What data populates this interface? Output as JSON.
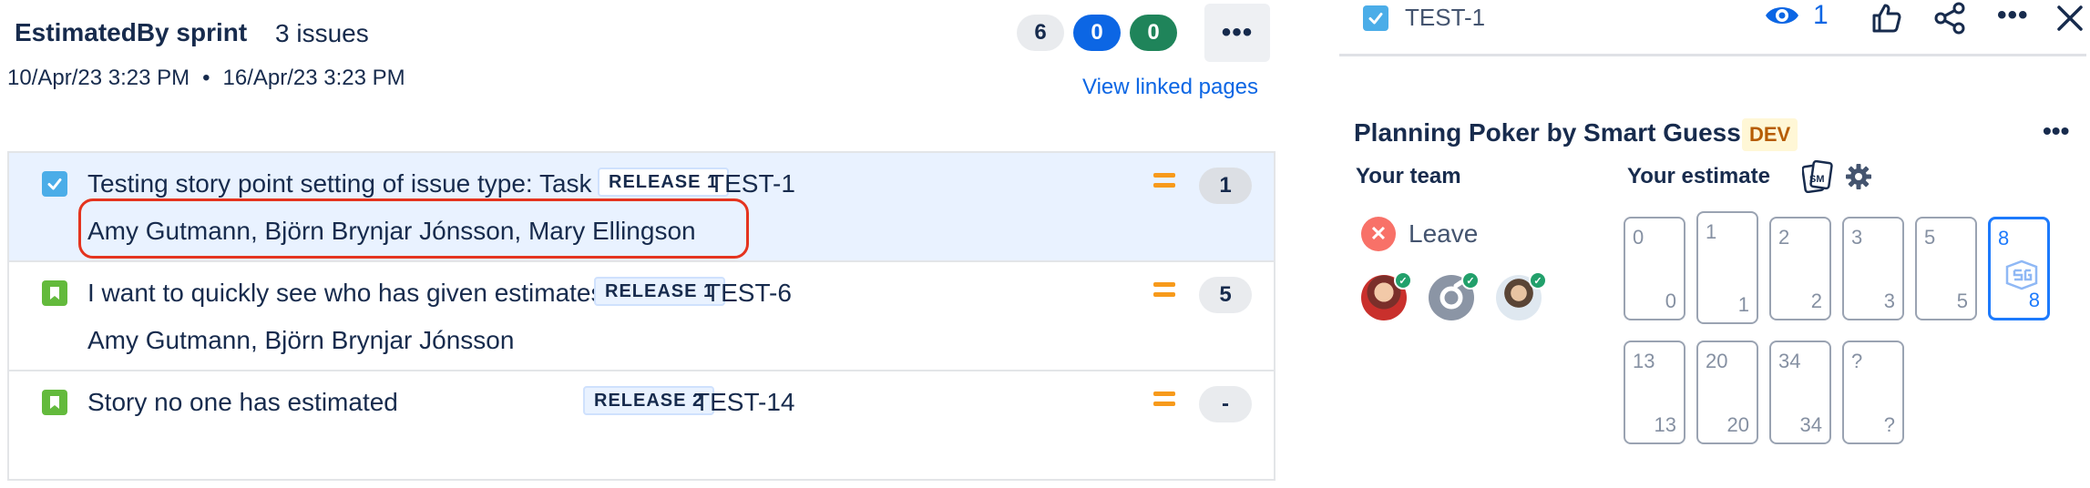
{
  "sprint": {
    "title": "EstimatedBy sprint",
    "issue_count": "3 issues",
    "start": "10/Apr/23 3:23 PM",
    "separator": "•",
    "end": "16/Apr/23 3:23 PM",
    "counts": {
      "todo": "6",
      "in_progress": "0",
      "done": "0"
    },
    "more": "•••",
    "view_linked": "View linked pages"
  },
  "issues": [
    {
      "type": "task",
      "summary": "Testing story point setting of issue type: Task",
      "estimators": "Amy Gutmann, Björn Brynjar Jónsson, Mary Ellingson",
      "release": "RELEASE 1",
      "key": "TEST-1",
      "priority": "medium",
      "points": "1",
      "selected": true
    },
    {
      "type": "story",
      "summary": "I want to quickly see who has given estimates",
      "estimators": "Amy Gutmann, Björn Brynjar Jónsson",
      "release": "RELEASE 1",
      "key": "TEST-6",
      "priority": "medium",
      "points": "5",
      "selected": false
    },
    {
      "type": "story",
      "summary": "Story no one has estimated",
      "estimators": "",
      "release": "RELEASE 2",
      "key": "TEST-14",
      "priority": "medium",
      "points": "-",
      "selected": false
    }
  ],
  "issue_panel": {
    "key": "TEST-1",
    "watchers": "1",
    "more": "•••"
  },
  "poker": {
    "title": "Planning Poker by Smart Guess",
    "badge": "DEV",
    "more": "•••",
    "team_label": "Your team",
    "estimate_label": "Your estimate",
    "leave": "Leave",
    "cards": [
      {
        "value": "0",
        "selected": false
      },
      {
        "value": "1",
        "selected": false
      },
      {
        "value": "2",
        "selected": false
      },
      {
        "value": "3",
        "selected": false
      },
      {
        "value": "5",
        "selected": false
      },
      {
        "value": "8",
        "selected": true
      },
      {
        "value": "13",
        "selected": false
      },
      {
        "value": "20",
        "selected": false
      },
      {
        "value": "34",
        "selected": false
      },
      {
        "value": "?",
        "selected": false
      }
    ]
  },
  "colors": {
    "accent": "#0c66e4",
    "selected_row": "#e9f2ff",
    "task": "#4bade8",
    "story": "#63ba3c",
    "priority_medium": "#f79a1b",
    "highlight": "#e4341f",
    "dev_badge": "#b65c02"
  }
}
